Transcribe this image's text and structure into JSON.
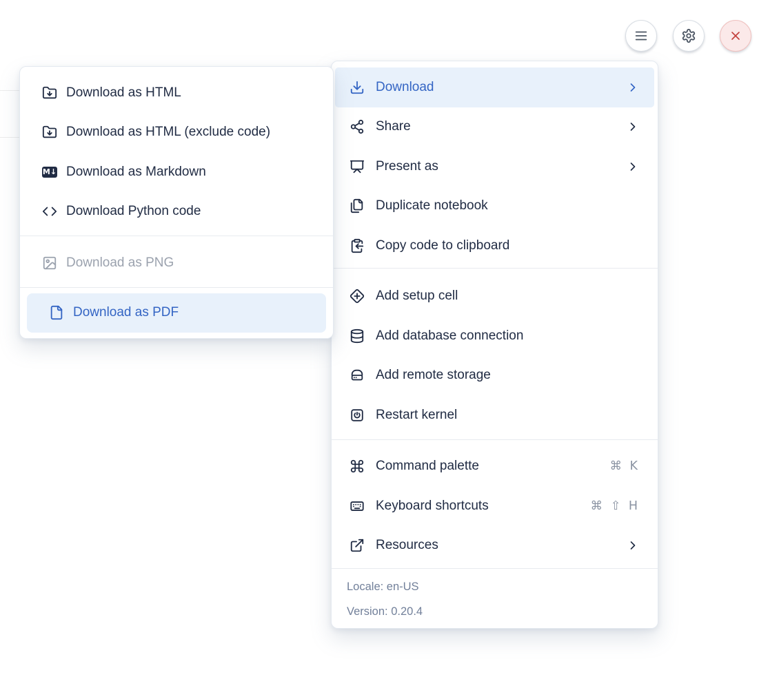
{
  "toolbar": {
    "menu_button": "menu",
    "settings_button": "settings",
    "close_button": "close"
  },
  "main_menu": {
    "items": [
      {
        "label": "Download",
        "state": "highlighted",
        "has_submenu": true
      },
      {
        "label": "Share",
        "has_submenu": true
      },
      {
        "label": "Present as",
        "has_submenu": true
      },
      {
        "label": "Duplicate notebook"
      },
      {
        "label": "Copy code to clipboard"
      },
      {
        "label": "Add setup cell"
      },
      {
        "label": "Add database connection"
      },
      {
        "label": "Add remote storage"
      },
      {
        "label": "Restart kernel"
      },
      {
        "label": "Command palette",
        "shortcut": "⌘ K"
      },
      {
        "label": "Keyboard shortcuts",
        "shortcut": "⌘ ⇧ H"
      },
      {
        "label": "Resources",
        "has_submenu": true
      }
    ],
    "footer": {
      "locale": "Locale: en-US",
      "version": "Version: 0.20.4"
    }
  },
  "download_submenu": {
    "markdown_badge": "M↓",
    "items": [
      {
        "label": "Download as HTML"
      },
      {
        "label": "Download as HTML (exclude code)"
      },
      {
        "label": "Download as Markdown"
      },
      {
        "label": "Download Python code"
      },
      {
        "label": "Download as PNG",
        "state": "disabled"
      },
      {
        "label": "Download as PDF",
        "state": "highlighted"
      }
    ]
  },
  "colors": {
    "accent": "#3465c4",
    "highlight_bg": "#e8f1fb",
    "text": "#212c44",
    "muted": "#8a93a2",
    "footer_text": "#72809a",
    "disabled": "#9ba2ae",
    "danger": "#c2403c",
    "danger_bg": "#fbe9e9",
    "danger_border": "#f0c1bf"
  }
}
